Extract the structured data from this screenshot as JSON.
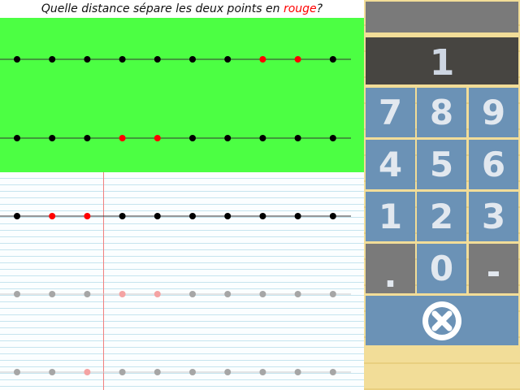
{
  "question": {
    "before": "Quelle distance sépare les deux points en ",
    "highlight": "rouge",
    "after": "?"
  },
  "colors": {
    "green_area": "#4cff43",
    "highlight": "#ff0000",
    "dot": "#000000",
    "faded_dot": "#a6a6a6",
    "faded_red_dot": "#f4a3a3",
    "key": "#6b92b6",
    "key_gray": "#7a7a7a",
    "display": "#474541",
    "panel": "#f2dd98"
  },
  "number_lines": [
    {
      "name": "line-1",
      "red": [
        7,
        8
      ],
      "faded": false
    },
    {
      "name": "line-2",
      "red": [
        3,
        4
      ],
      "faded": false
    },
    {
      "name": "line-3",
      "red": [
        1,
        2
      ],
      "faded": false
    },
    {
      "name": "line-4",
      "red": [
        3,
        4
      ],
      "faded": true
    },
    {
      "name": "line-5",
      "red": [
        2
      ],
      "faded": true
    }
  ],
  "keypad": {
    "display": "1",
    "keys": [
      "7",
      "8",
      "9",
      "4",
      "5",
      "6",
      "1",
      "2",
      "3",
      ".",
      "0",
      "-"
    ],
    "clear_icon": "clear-circle-x-icon"
  }
}
